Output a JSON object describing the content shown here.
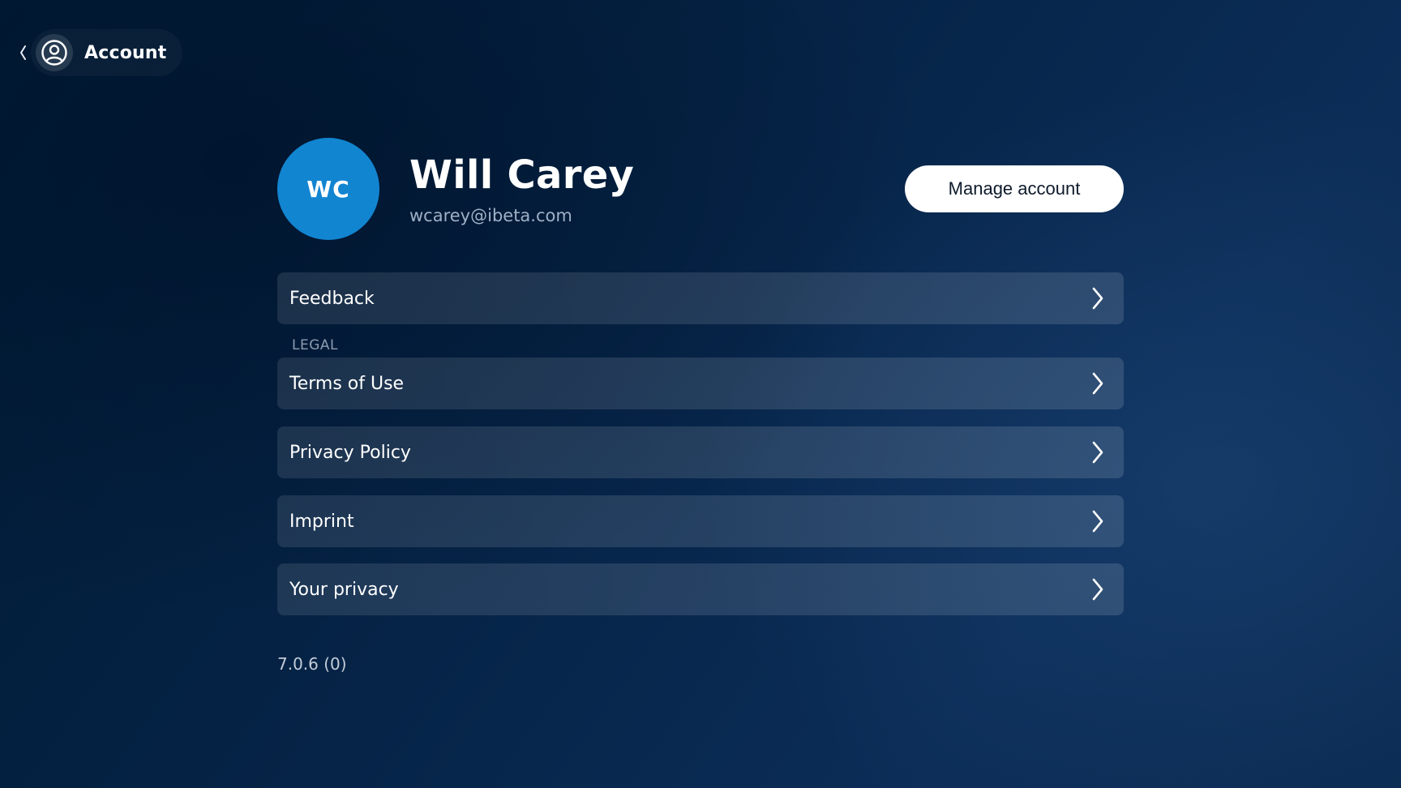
{
  "header": {
    "back_icon": "chevron-left-icon",
    "account_icon": "user-circle-icon",
    "title": "Account"
  },
  "profile": {
    "initials": "WC",
    "name": "Will Carey",
    "email": "wcarey@ibeta.com",
    "avatar_color": "#1285d1",
    "manage_button_label": "Manage account"
  },
  "menu": {
    "feedback_label": "Feedback",
    "legal_section_label": "LEGAL",
    "items": [
      {
        "label": "Terms of Use",
        "icon": "chevron-right-icon"
      },
      {
        "label": "Privacy Policy",
        "icon": "chevron-right-icon"
      },
      {
        "label": "Imprint",
        "icon": "chevron-right-icon"
      },
      {
        "label": "Your privacy",
        "icon": "chevron-right-icon"
      }
    ]
  },
  "footer": {
    "version": "7.0.6 (0)"
  }
}
